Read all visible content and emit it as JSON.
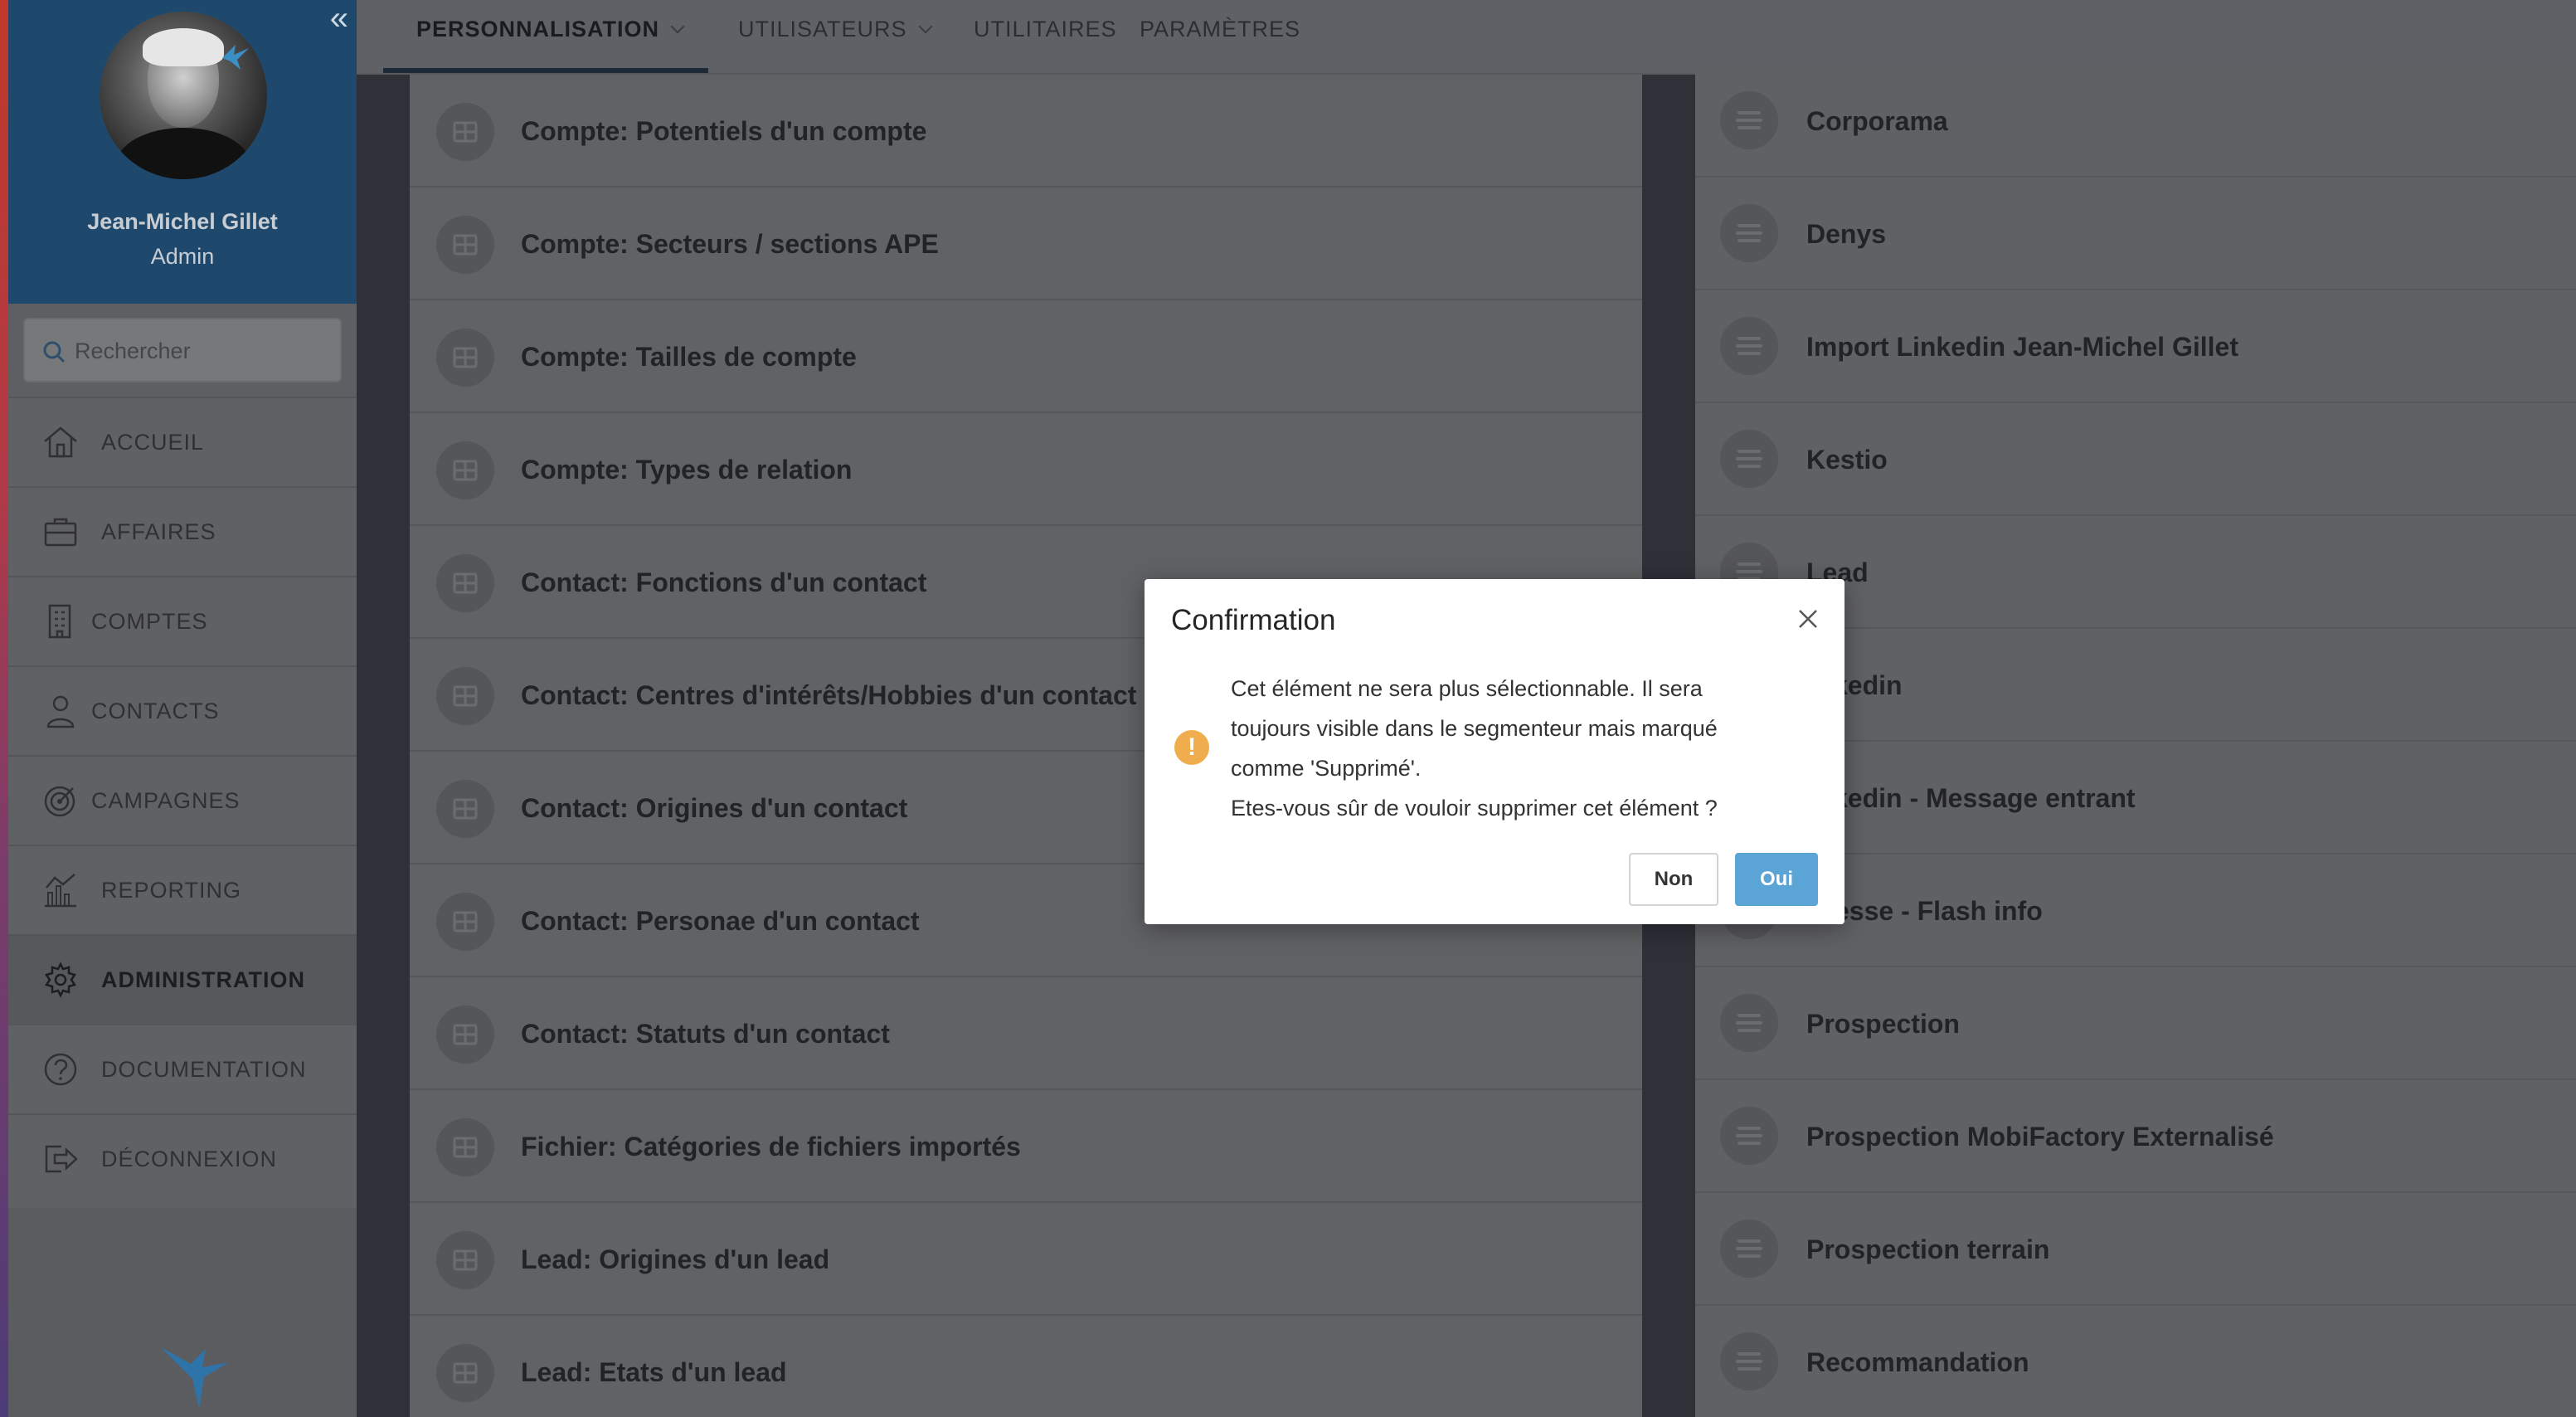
{
  "profile": {
    "name": "Jean-Michel Gillet",
    "role": "Admin"
  },
  "search": {
    "placeholder": "Rechercher"
  },
  "nav": {
    "items": [
      {
        "label": "ACCUEIL",
        "icon": "home-icon"
      },
      {
        "label": "AFFAIRES",
        "icon": "briefcase-icon"
      },
      {
        "label": "COMPTES",
        "icon": "building-icon"
      },
      {
        "label": "CONTACTS",
        "icon": "person-icon"
      },
      {
        "label": "CAMPAGNES",
        "icon": "target-icon"
      },
      {
        "label": "REPORTING",
        "icon": "chart-icon"
      },
      {
        "label": "ADMINISTRATION",
        "icon": "gear-icon",
        "active": true
      },
      {
        "label": "DOCUMENTATION",
        "icon": "question-icon"
      },
      {
        "label": "DÉCONNEXION",
        "icon": "logout-icon"
      }
    ]
  },
  "tabs": [
    {
      "label": "PERSONNALISATION",
      "active": true,
      "dropdown": true
    },
    {
      "label": "UTILISATEURS",
      "dropdown": true
    },
    {
      "label": "UTILITAIRES"
    },
    {
      "label": "PARAMÈTRES"
    }
  ],
  "left_list": [
    "Compte: Potentiels d'un compte",
    "Compte: Secteurs / sections APE",
    "Compte: Tailles de compte",
    "Compte: Types de relation",
    "Contact: Fonctions d'un contact",
    "Contact: Centres d'intérêts/Hobbies d'un contact",
    "Contact: Origines d'un contact",
    "Contact: Personae d'un contact",
    "Contact: Statuts d'un contact",
    "Fichier: Catégories de fichiers importés",
    "Lead: Origines d'un lead",
    "Lead: Etats d'un lead"
  ],
  "right_list": [
    "Corporama",
    "Denys",
    "Import Linkedin Jean-Michel Gillet",
    "Kestio",
    "Lead",
    "kedin",
    "kedin - Message entrant",
    "esse - Flash info",
    "Prospection",
    "Prospection MobiFactory Externalisé",
    "Prospection terrain",
    "Recommandation"
  ],
  "dialog": {
    "title": "Confirmation",
    "line1": "Cet élément ne sera plus sélectionnable. Il sera",
    "line2": "toujours visible dans le segmenteur mais marqué",
    "line3": "comme 'Supprimé'.",
    "line4": "Etes-vous sûr de vouloir supprimer cet élément ?",
    "no_label": "Non",
    "yes_label": "Oui",
    "warning_symbol": "!"
  },
  "colors": {
    "sidebar_header": "#1f496c",
    "accent_button": "#5aa5d6",
    "warning": "#f0ad4e",
    "overlay_bg": "#606165"
  }
}
